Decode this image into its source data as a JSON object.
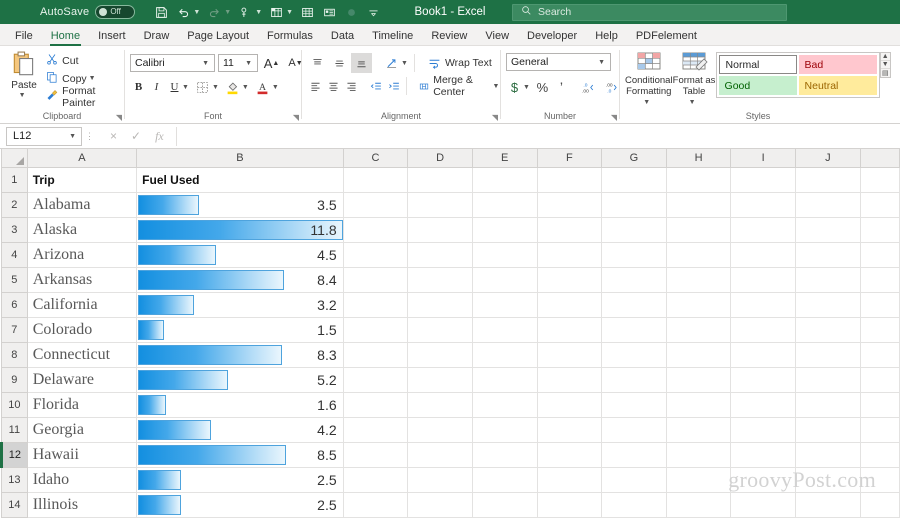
{
  "titlebar": {
    "autosave_label": "AutoSave",
    "autosave_state": "Off",
    "document_title": "Book1 - Excel",
    "search_placeholder": "Search",
    "qat": [
      {
        "name": "save-icon",
        "label": "Save"
      },
      {
        "name": "undo-icon",
        "label": "Undo"
      },
      {
        "name": "redo-icon",
        "label": "Redo"
      },
      {
        "name": "touch-mouse-mode-icon",
        "label": "Touch/Mouse Mode"
      },
      {
        "name": "new-sheet-icon",
        "label": "New Sheet"
      },
      {
        "name": "table-icon",
        "label": "Table"
      },
      {
        "name": "form-icon",
        "label": "Form"
      },
      {
        "name": "record-icon",
        "label": "Record"
      },
      {
        "name": "customize-qat-icon",
        "label": "Customize Quick Access Toolbar"
      }
    ]
  },
  "ribbon": {
    "tabs": [
      {
        "label": "File",
        "active": false
      },
      {
        "label": "Home",
        "active": true
      },
      {
        "label": "Insert",
        "active": false
      },
      {
        "label": "Draw",
        "active": false
      },
      {
        "label": "Page Layout",
        "active": false
      },
      {
        "label": "Formulas",
        "active": false
      },
      {
        "label": "Data",
        "active": false
      },
      {
        "label": "Timeline",
        "active": false
      },
      {
        "label": "Review",
        "active": false
      },
      {
        "label": "View",
        "active": false
      },
      {
        "label": "Developer",
        "active": false
      },
      {
        "label": "Help",
        "active": false
      },
      {
        "label": "PDFelement",
        "active": false
      }
    ],
    "clipboard": {
      "group_label": "Clipboard",
      "paste_label": "Paste",
      "cut_label": "Cut",
      "copy_label": "Copy",
      "format_painter_label": "Format Painter"
    },
    "font": {
      "group_label": "Font",
      "font_name": "Calibri",
      "font_size": "11",
      "grow_font_label": "A",
      "shrink_font_label": "A",
      "bold_label": "B",
      "italic_label": "I",
      "underline_label": "U"
    },
    "alignment": {
      "group_label": "Alignment",
      "wrap_text_label": "Wrap Text",
      "merge_center_label": "Merge & Center"
    },
    "number": {
      "group_label": "Number",
      "format": "General",
      "currency_label": "$",
      "percent_label": "%",
      "comma_label": "’"
    },
    "styles": {
      "group_label": "Styles",
      "conditional_formatting_label": "Conditional Formatting",
      "format_as_table_label": "Format as Table",
      "gallery": [
        {
          "label": "Normal",
          "bg": "#ffffff",
          "fg": "#262626"
        },
        {
          "label": "Bad",
          "bg": "#ffc7ce",
          "fg": "#9c0006"
        },
        {
          "label": "Good",
          "bg": "#c6efce",
          "fg": "#006100"
        },
        {
          "label": "Neutral",
          "bg": "#ffeb9c",
          "fg": "#9c6500"
        }
      ]
    }
  },
  "formula_bar": {
    "name_box": "L12",
    "cancel_icon": "×",
    "enter_icon": "✓",
    "function_icon": "fx",
    "formula_value": ""
  },
  "grid": {
    "columns": [
      "A",
      "B",
      "C",
      "D",
      "E",
      "F",
      "G",
      "H",
      "I",
      "J"
    ],
    "selected_row": 12,
    "watermark": "groovyPost.com",
    "headers": {
      "trip": "Trip",
      "fuel": "Fuel Used"
    },
    "rows": [
      {
        "num": "1",
        "trip": "Trip",
        "fuel": "Fuel Used",
        "is_header": true
      },
      {
        "num": "2",
        "trip": "Alabama",
        "fuel": "3.5"
      },
      {
        "num": "3",
        "trip": "Alaska",
        "fuel": "11.8"
      },
      {
        "num": "4",
        "trip": "Arizona",
        "fuel": "4.5"
      },
      {
        "num": "5",
        "trip": "Arkansas",
        "fuel": "8.4"
      },
      {
        "num": "6",
        "trip": "California",
        "fuel": "3.2"
      },
      {
        "num": "7",
        "trip": "Colorado",
        "fuel": "1.5"
      },
      {
        "num": "8",
        "trip": "Connecticut",
        "fuel": "8.3"
      },
      {
        "num": "9",
        "trip": "Delaware",
        "fuel": "5.2"
      },
      {
        "num": "10",
        "trip": "Florida",
        "fuel": "1.6"
      },
      {
        "num": "11",
        "trip": "Georgia",
        "fuel": "4.2"
      },
      {
        "num": "12",
        "trip": "Hawaii",
        "fuel": "8.5"
      },
      {
        "num": "13",
        "trip": "Idaho",
        "fuel": "2.5"
      },
      {
        "num": "14",
        "trip": "Illinois",
        "fuel": "2.5"
      }
    ]
  },
  "chart_data": {
    "type": "bar",
    "title": "Fuel Used",
    "categories": [
      "Alabama",
      "Alaska",
      "Arizona",
      "Arkansas",
      "California",
      "Colorado",
      "Connecticut",
      "Delaware",
      "Florida",
      "Georgia",
      "Hawaii",
      "Idaho",
      "Illinois"
    ],
    "values": [
      3.5,
      11.8,
      4.5,
      8.4,
      3.2,
      1.5,
      8.3,
      5.2,
      1.6,
      4.2,
      8.5,
      2.5,
      2.5
    ],
    "xlabel": "Trip",
    "ylabel": "Fuel Used",
    "ylim": [
      0,
      11.8
    ],
    "grid": false,
    "legend": "none",
    "note": "Excel conditional-formatting data bars, blue gradient, max bar = 11.8"
  }
}
